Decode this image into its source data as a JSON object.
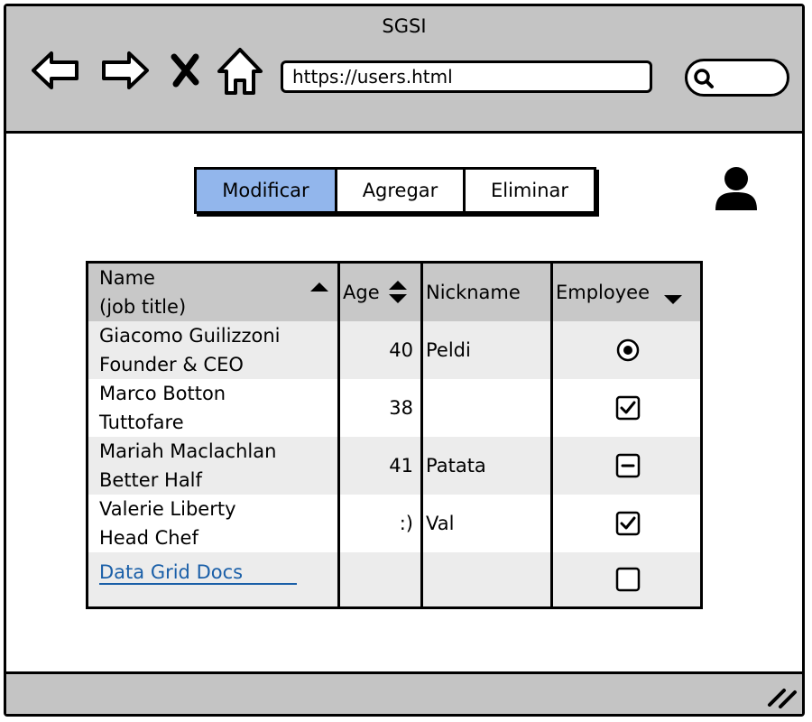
{
  "window": {
    "title": "SGSI"
  },
  "address_bar": {
    "url": "https://users.html"
  },
  "nav_icons": [
    "back-arrow-icon",
    "forward-arrow-icon",
    "close-x-icon",
    "home-icon"
  ],
  "search": {
    "icon": "search-icon",
    "value": ""
  },
  "tabs": [
    {
      "label": "Modificar",
      "active": true
    },
    {
      "label": "Agregar",
      "active": false
    },
    {
      "label": "Eliminar",
      "active": false
    }
  ],
  "user": {
    "icon": "user-avatar-icon"
  },
  "grid": {
    "headers": {
      "name_line1": "Name",
      "name_line2": "(job title)",
      "age": "Age",
      "nickname": "Nickname",
      "employee": "Employee"
    },
    "rows": [
      {
        "name": "Giacomo Guilizzoni",
        "title": "Founder & CEO",
        "age": "40",
        "nickname": "Peldi",
        "employee": "radio-selected"
      },
      {
        "name": "Marco Botton",
        "title": "Tuttofare",
        "age": "38",
        "nickname": "",
        "employee": "checkbox-checked"
      },
      {
        "name": "Mariah Maclachlan",
        "title": "Better Half",
        "age": "41",
        "nickname": "Patata",
        "employee": "checkbox-indeterminate"
      },
      {
        "name": "Valerie Liberty",
        "title": "Head Chef",
        "age": ":)",
        "nickname": "Val",
        "employee": "checkbox-checked"
      }
    ],
    "footer_link": "Data Grid Docs",
    "footer_employee": "checkbox-unchecked"
  },
  "colors": {
    "chrome": "#c4c4c4",
    "active_tab": "#92b6ec",
    "link": "#1a5fa8",
    "row_alt": "#ececec",
    "header": "#c8c8c8"
  }
}
